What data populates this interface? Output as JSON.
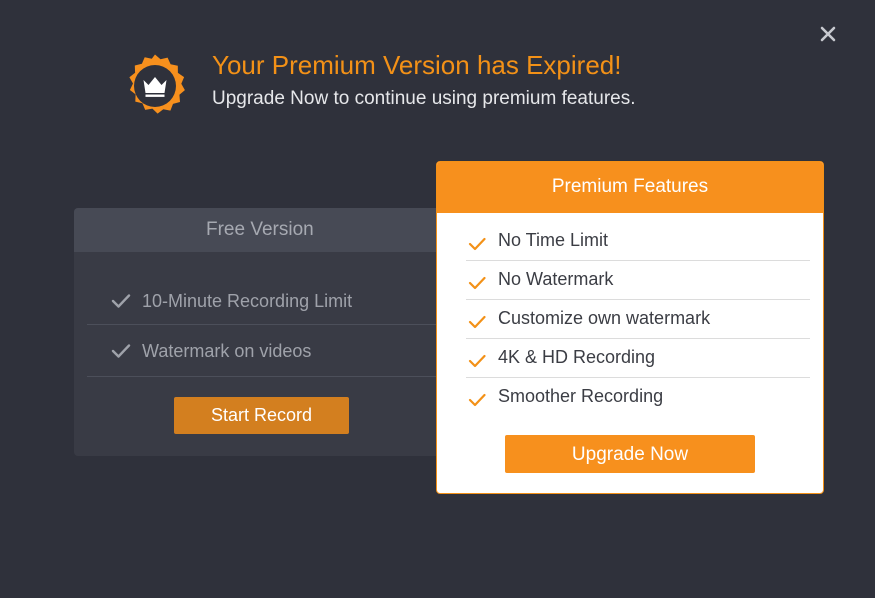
{
  "header": {
    "title": "Your Premium Version has Expired!",
    "subtitle": "Upgrade Now to continue using premium features.",
    "badge_icon": "crown-icon",
    "close_icon": "close-icon"
  },
  "free_version": {
    "title": "Free Version",
    "items": [
      {
        "label": "10-Minute Recording Limit",
        "icon": "check-icon"
      },
      {
        "label": "Watermark on videos",
        "icon": "check-icon"
      }
    ],
    "button_label": "Start Record"
  },
  "premium": {
    "title": "Premium Features",
    "items": [
      {
        "label": "No Time Limit",
        "icon": "check-icon"
      },
      {
        "label": "No Watermark",
        "icon": "check-icon"
      },
      {
        "label": "Customize own watermark",
        "icon": "check-icon"
      },
      {
        "label": "4K & HD Recording",
        "icon": "check-icon"
      },
      {
        "label": "Smoother Recording",
        "icon": "check-icon"
      }
    ],
    "button_label": "Upgrade Now"
  },
  "colors": {
    "background": "#2f313b",
    "accent": "#f7901d",
    "title": "#f39117",
    "free_card": "#393b45",
    "free_header": "#474a55",
    "start_button": "#d37f1f"
  }
}
